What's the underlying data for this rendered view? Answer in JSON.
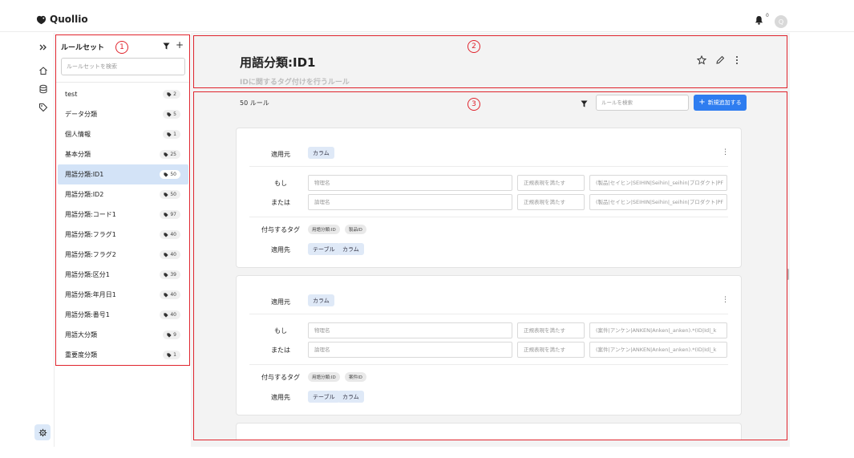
{
  "app": {
    "name": "Quollio",
    "notification_count": "0",
    "avatar_initial": "Q"
  },
  "sidebar": {
    "title": "ルールセット",
    "search_placeholder": "ルールセットを検索",
    "items": [
      {
        "label": "test",
        "count": "2"
      },
      {
        "label": "データ分類",
        "count": "5"
      },
      {
        "label": "個人情報",
        "count": "1"
      },
      {
        "label": "基本分類",
        "count": "25"
      },
      {
        "label": "用語分類:ID1",
        "count": "50",
        "active": true
      },
      {
        "label": "用語分類:ID2",
        "count": "50"
      },
      {
        "label": "用語分類:コード1",
        "count": "97"
      },
      {
        "label": "用語分類:フラグ1",
        "count": "40"
      },
      {
        "label": "用語分類:フラグ2",
        "count": "40"
      },
      {
        "label": "用語分類:区分1",
        "count": "39"
      },
      {
        "label": "用語分類:年月日1",
        "count": "40"
      },
      {
        "label": "用語分類:番号1",
        "count": "40"
      },
      {
        "label": "用語大分類",
        "count": "9"
      },
      {
        "label": "重要度分類",
        "count": "1"
      }
    ]
  },
  "header": {
    "title": "用語分類:ID1",
    "subtitle": "IDに関するタグ付けを行うルール"
  },
  "content": {
    "rule_count": "50 ルール",
    "search_placeholder": "ルールを検索",
    "new_button_label": "新規追加する",
    "labels": {
      "source": "適用元",
      "if": "もし",
      "or": "または",
      "tags": "付与するタグ",
      "target": "適用先"
    },
    "cards": [
      {
        "source_chip": "カラム",
        "conditions": [
          {
            "field": "物理名",
            "operator": "正規表現を満たす",
            "value": "(製品|セイヒン|SEIHIN|Seihin|_seihin|プロダクト|PF"
          },
          {
            "field": "論理名",
            "operator": "正規表現を満たす",
            "value": "(製品|セイヒン|SEIHIN|Seihin|_seihin|プロダクト|PF"
          }
        ],
        "tags": [
          "用語分類:ID",
          "製品ID"
        ],
        "targets": [
          "テーブル",
          "カラム"
        ]
      },
      {
        "source_chip": "カラム",
        "conditions": [
          {
            "field": "物理名",
            "operator": "正規表現を満たす",
            "value": "(案件|アンケン|ANKEN|Anken|_anken).*(ID|Id|_k"
          },
          {
            "field": "論理名",
            "operator": "正規表現を満たす",
            "value": "(案件|アンケン|ANKEN|Anken|_anken).*(ID|Id|_k"
          }
        ],
        "tags": [
          "用語分類:ID",
          "案件ID"
        ],
        "targets": [
          "テーブル",
          "カラム"
        ]
      }
    ]
  },
  "annotations": [
    "1",
    "2",
    "3"
  ],
  "colors": {
    "accent": "#2e7df0",
    "annotation": "#e0242d",
    "active_item": "#d3e3f7"
  }
}
